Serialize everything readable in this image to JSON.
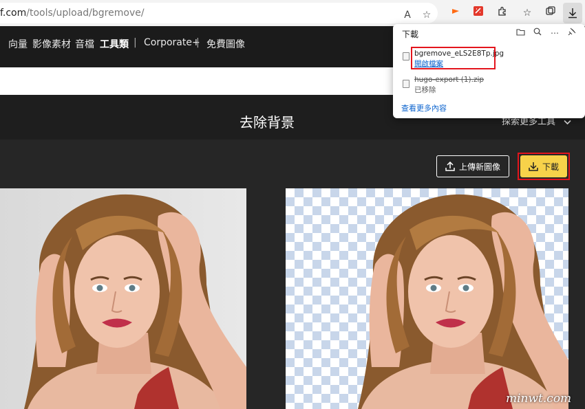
{
  "browser": {
    "url_host": "f.com",
    "url_path": "/tools/upload/bgremove/",
    "read_aloud_icon": "A",
    "colors": {
      "bar": "#f3f3f3"
    }
  },
  "nav": {
    "items": [
      "向量",
      "影像素材",
      "音檔",
      "工具類",
      "Corporate+",
      "免費圖像"
    ],
    "separator": "|"
  },
  "page": {
    "title": "去除背景",
    "explore_more": "探索更多工具"
  },
  "actions": {
    "upload_label": "上傳新圖像",
    "download_label": "下載",
    "accent": "#f7d24a"
  },
  "downloads_panel": {
    "title": "下載",
    "files": [
      {
        "name": "bgremove_eLS2E8Tp.jpg",
        "action": "開啟檔案"
      },
      {
        "name": "hugo-export (1).zip",
        "status": "已移除"
      }
    ],
    "see_more": "查看更多內容",
    "link_color": "#0b63ce"
  },
  "watermark": "minwt.com"
}
